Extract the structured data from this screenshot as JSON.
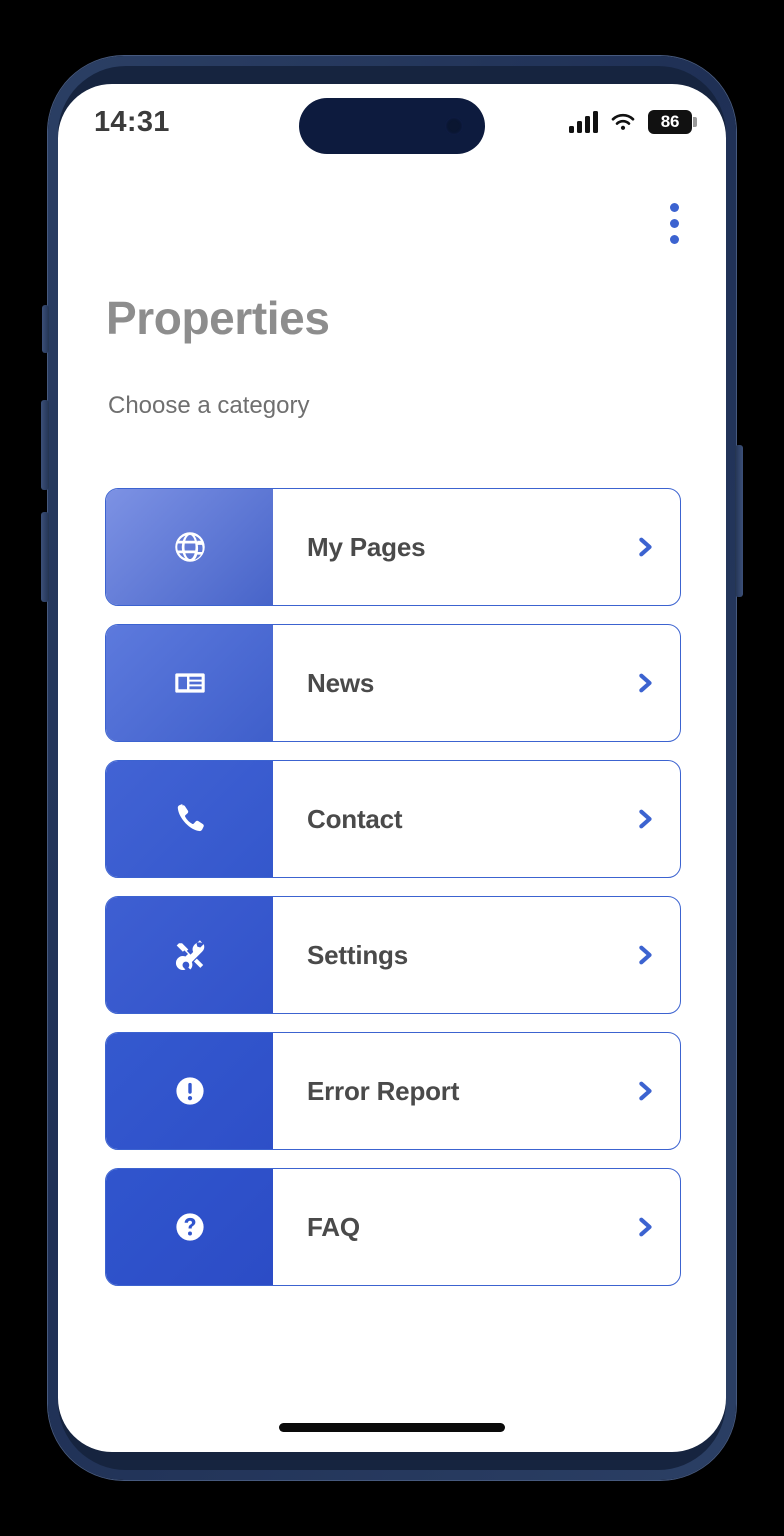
{
  "status_bar": {
    "time": "14:31",
    "signal_icon": "signal-bars-icon",
    "wifi_icon": "wifi-icon",
    "battery_percent": "86",
    "battery_icon": "battery-icon"
  },
  "header": {
    "menu_icon": "kebab-menu-icon",
    "title": "Properties",
    "subtitle": "Choose a category"
  },
  "theme": {
    "accent": "#3c63d0",
    "title_color": "#8d8d8d",
    "label_color": "#4a4a4a",
    "frame_color": "#2b3f64",
    "island_color": "#0d1b3e"
  },
  "categories": [
    {
      "label": "My Pages",
      "icon": "globe-icon",
      "tile_gradient_from": "#7d92e4",
      "tile_gradient_to": "#4764c9",
      "chevron_icon": "chevron-right-icon"
    },
    {
      "label": "News",
      "icon": "newspaper-icon",
      "tile_gradient_from": "#5d7add",
      "tile_gradient_to": "#3f5fcb",
      "chevron_icon": "chevron-right-icon"
    },
    {
      "label": "Contact",
      "icon": "phone-icon",
      "tile_gradient_from": "#4263d4",
      "tile_gradient_to": "#3457cc",
      "chevron_icon": "chevron-right-icon"
    },
    {
      "label": "Settings",
      "icon": "tools-icon",
      "tile_gradient_from": "#3e5fd2",
      "tile_gradient_to": "#3253ca",
      "chevron_icon": "chevron-right-icon"
    },
    {
      "label": "Error Report",
      "icon": "alert-circle-icon",
      "tile_gradient_from": "#3459cf",
      "tile_gradient_to": "#2e4fc8",
      "chevron_icon": "chevron-right-icon"
    },
    {
      "label": "FAQ",
      "icon": "help-circle-icon",
      "tile_gradient_from": "#3055cd",
      "tile_gradient_to": "#2c4cc6",
      "chevron_icon": "chevron-right-icon"
    }
  ],
  "home_indicator": "home-indicator"
}
